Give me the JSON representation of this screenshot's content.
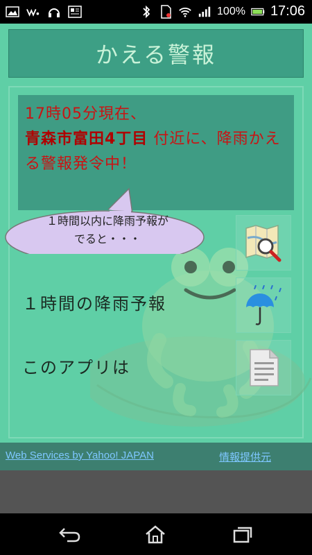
{
  "status_bar": {
    "battery": "100%",
    "time": "17:06",
    "icons_left": [
      "image-icon",
      "walkman-icon",
      "headphones-icon",
      "newspaper-icon"
    ],
    "icons_right": [
      "bluetooth-off-icon",
      "sim-icon",
      "wifi-icon",
      "signal-icon",
      "battery-icon"
    ]
  },
  "header": {
    "title": "かえる警報"
  },
  "notice": {
    "line1": "17時05分現在、",
    "place": "青森市富田4丁目",
    "rest": "付近に、降雨かえる警報発令中！"
  },
  "bubble": {
    "text": "１時間以内に降雨予報がでると・・・"
  },
  "menu": {
    "forecast_label": "１時間の降雨予報",
    "about_label": "このアプリは"
  },
  "links": {
    "yahoo": "Web Services by Yahoo! JAPAN",
    "provider": "情報提供元"
  },
  "colors": {
    "background": "#5fcfa6",
    "title_bar": "#3d9f85",
    "notice_text": "#c81414",
    "link": "#7ec7ff"
  }
}
